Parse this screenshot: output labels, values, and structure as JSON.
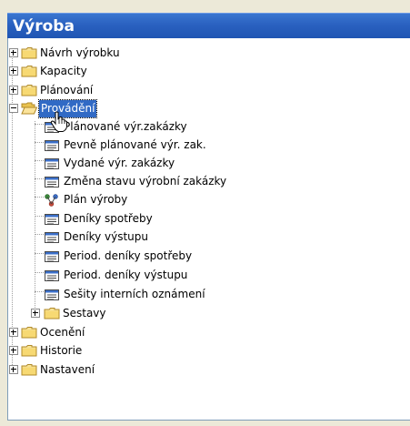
{
  "window": {
    "title": "Výroba"
  },
  "tree": {
    "n0": {
      "label": "Návrh výrobku"
    },
    "n1": {
      "label": "Kapacity"
    },
    "n2": {
      "label": "Plánování"
    },
    "n3": {
      "label": "Provádění"
    },
    "n3c0": {
      "label": "Plánované výr.zakázky"
    },
    "n3c1": {
      "label": "Pevně plánované výr. zak."
    },
    "n3c2": {
      "label": "Vydané výr. zakázky"
    },
    "n3c3": {
      "label": "Změna stavu výrobní zakázky"
    },
    "n3c4": {
      "label": "Plán výroby"
    },
    "n3c5": {
      "label": "Deníky spotřeby"
    },
    "n3c6": {
      "label": "Deníky výstupu"
    },
    "n3c7": {
      "label": "Period. deníky spotřeby"
    },
    "n3c8": {
      "label": "Period. deníky výstupu"
    },
    "n3c9": {
      "label": "Sešity interních oznámení"
    },
    "n3c10": {
      "label": "Sestavy"
    },
    "n4": {
      "label": "Ocenění"
    },
    "n5": {
      "label": "Historie"
    },
    "n6": {
      "label": "Nastavení"
    }
  },
  "colors": {
    "title_bar": "#2a61c0",
    "selection": "#316ac5",
    "folder": "#f5d66b"
  }
}
